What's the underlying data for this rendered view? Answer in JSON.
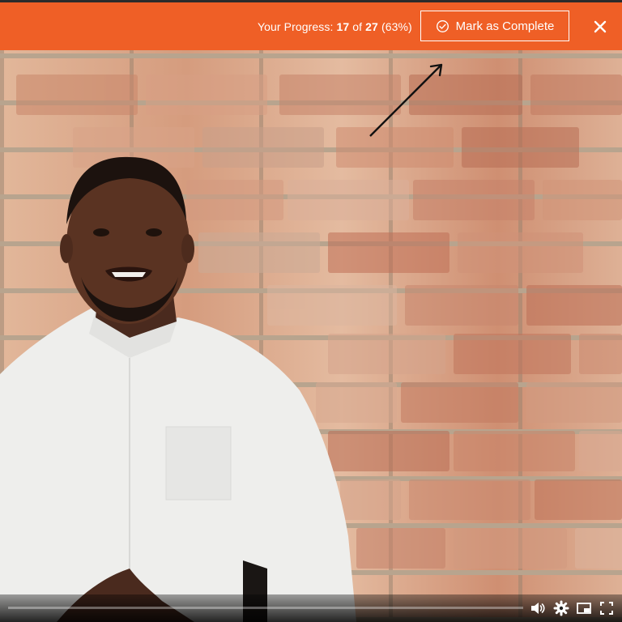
{
  "header": {
    "progress_label": "Your Progress:",
    "progress_current": "17",
    "progress_of": "of",
    "progress_total": "27",
    "progress_percent": "(63%)",
    "mark_complete_label": "Mark as Complete",
    "accent_color": "#ef5f26"
  },
  "player": {
    "icons": [
      "volume-icon",
      "settings-gear-icon",
      "picture-in-picture-icon",
      "fullscreen-icon"
    ]
  }
}
